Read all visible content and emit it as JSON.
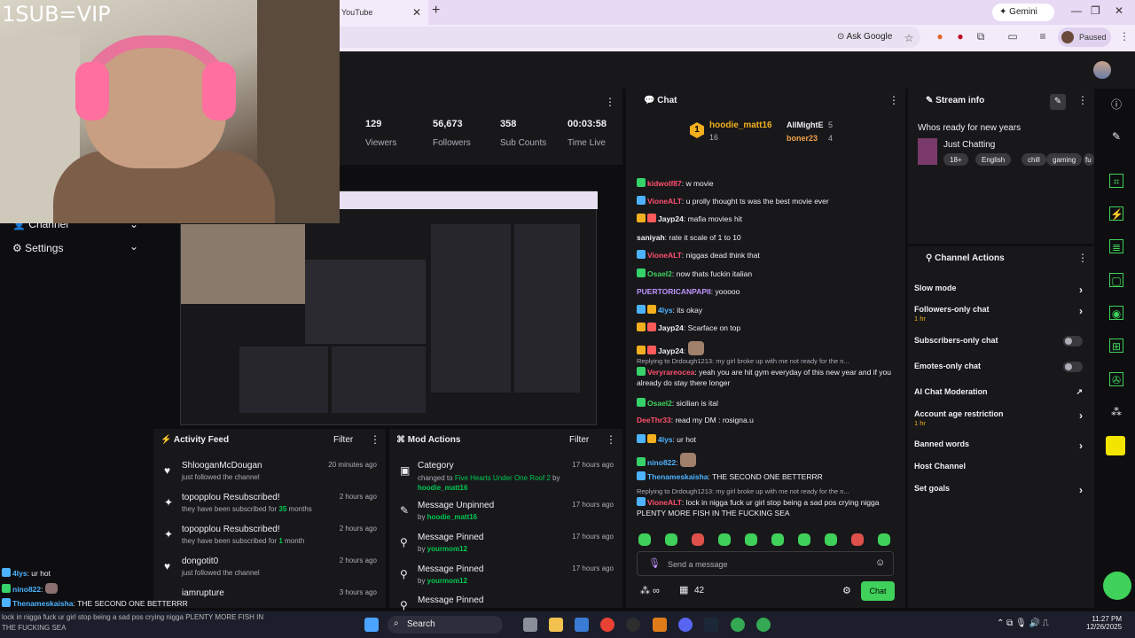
{
  "browser": {
    "tab_title": "YouTube",
    "gemini_label": "Gemini",
    "ask_google": "Ask Google",
    "paused": "Paused"
  },
  "webcam": {
    "tag": "1SUB=VIP"
  },
  "left_nav": [
    {
      "label": "Channel"
    },
    {
      "label": "Settings"
    }
  ],
  "stats": [
    {
      "value": "129",
      "label": "Viewers"
    },
    {
      "value": "56,673",
      "label": "Followers"
    },
    {
      "value": "358",
      "label": "Sub Counts"
    },
    {
      "value": "00:03:58",
      "label": "Time Live"
    }
  ],
  "activity_feed": {
    "title": "Activity Feed",
    "filter": "Filter",
    "items": [
      {
        "title": "ShlooganMcDougan",
        "sub": "just followed the channel",
        "time": "20 minutes ago"
      },
      {
        "title": "topopplou Resubscribed!",
        "sub_pre": "they have been subscribed for ",
        "sub_num": "35",
        "sub_post": " months",
        "time": "2 hours ago"
      },
      {
        "title": "topopplou Resubscribed!",
        "sub_pre": "they have been subscribed for ",
        "sub_num": "1",
        "sub_post": " month",
        "time": "2 hours ago"
      },
      {
        "title": "dongotit0",
        "sub": "just followed the channel",
        "time": "2 hours ago"
      },
      {
        "title": "iamrupture",
        "time": "3 hours ago"
      }
    ]
  },
  "mod_actions": {
    "title": "Mod Actions",
    "filter": "Filter",
    "items": [
      {
        "title": "Category",
        "sub_pre": "changed to ",
        "sub_green": "Five Hearts Under One Roof 2",
        "sub_mid": " by",
        "sub_user": "hoodie_matt16",
        "time": "17 hours ago"
      },
      {
        "title": "Message Unpinned",
        "sub_pre": "by ",
        "sub_user": "hoodie_matt16",
        "time": "17 hours ago"
      },
      {
        "title": "Message Pinned",
        "sub_pre": "by ",
        "sub_user": "yourmom12",
        "time": "17 hours ago"
      },
      {
        "title": "Message Pinned",
        "sub_pre": "by ",
        "sub_user": "yourmom12",
        "time": "17 hours ago"
      },
      {
        "title": "Message Pinned",
        "time": ""
      }
    ]
  },
  "chat": {
    "title": "Chat",
    "leaderboard": {
      "first": {
        "name": "hoodie_matt16",
        "count": "16"
      },
      "second": {
        "name": "AllMightE",
        "count": "5"
      },
      "third": {
        "name": "boner23",
        "count": "4"
      }
    },
    "messages": [
      {
        "user": "kidwolf87",
        "color": "#ff4f6e",
        "text": ": w movie"
      },
      {
        "user": "VioneALT",
        "color": "#ff4f6e",
        "text": ": u prolly thought ts was the best movie ever"
      },
      {
        "user": "Jayp24",
        "color": "#efeff1",
        "text": ": mafia movies hit"
      },
      {
        "user": "saniyah",
        "color": "#efeff1",
        "text": ": rate it scale of 1 to 10"
      },
      {
        "user": "VioneALT",
        "color": "#ff4f6e",
        "text": ": niggas dead think that"
      },
      {
        "user": "Osael2",
        "color": "#3fd15a",
        "text": ": now thats fuckin italian"
      },
      {
        "user": "PUERTORICANPAPII",
        "color": "#bf94ff",
        "text": ": yooooo"
      },
      {
        "user": "4lys",
        "color": "#4db3ff",
        "text": ": its okay"
      },
      {
        "user": "Jayp24",
        "color": "#efeff1",
        "text": ": Scarface on top"
      },
      {
        "user": "Jayp24",
        "color": "#efeff1",
        "text": ":"
      },
      {
        "reply": "Replying to Drdough1213: my girl broke up with me not ready for the n...",
        "user": "Veryrareocea",
        "color": "#ff4f6e",
        "text": ": yeah you are hit gym everyday of this new year and if you already do stay there longer"
      },
      {
        "user": "Osael2",
        "color": "#3fd15a",
        "text": ": sicilian is ital"
      },
      {
        "user": "DeeThr33",
        "color": "#ff4f6e",
        "text": ": read my DM : rosigna.u"
      },
      {
        "user": "4lys",
        "color": "#4db3ff",
        "text": ": ur hot"
      },
      {
        "user": "nino822",
        "color": "#4db3ff",
        "text": ":"
      },
      {
        "user": "Thenameskaisha",
        "color": "#4db3ff",
        "text": ": THE SECOND ONE BETTERRR"
      },
      {
        "reply": "Replying to Drdough1213: my girl broke up with me not ready for the n...",
        "user": "VioneALT",
        "color": "#ff4f6e",
        "text": ": lock in nigga fuck ur girl stop being a sad pos crying nigga PLENTY MORE FISH IN THE FUCKING SEA"
      }
    ],
    "send_placeholder": "Send a message",
    "points": "42",
    "chat_button": "Chat"
  },
  "stream_info": {
    "title": "Stream info",
    "stream_title": "Whos ready for new years",
    "category": "Just Chatting",
    "tags": [
      "18+",
      "English",
      "chill",
      "gaming",
      "fu"
    ]
  },
  "channel_actions": {
    "title": "Channel Actions",
    "items": [
      {
        "label": "Slow mode",
        "control": "chevron"
      },
      {
        "label": "Followers-only chat",
        "sub": "1 hr",
        "control": "chevron"
      },
      {
        "label": "Subscribers-only chat",
        "control": "toggle"
      },
      {
        "label": "Emotes-only chat",
        "control": "toggle"
      },
      {
        "label": "AI Chat Moderation",
        "control": "external"
      },
      {
        "label": "Account age restriction",
        "sub": "1 hr",
        "control": "chevron"
      },
      {
        "label": "Banned words",
        "control": "chevron"
      },
      {
        "label": "Host Channel",
        "control": "none"
      },
      {
        "label": "Set goals",
        "control": "chevron"
      }
    ]
  },
  "overlay_chat": [
    {
      "user": "4lys",
      "text": ": ur hot"
    },
    {
      "user": "nino822",
      "text": ":"
    },
    {
      "user": "Thenameskaisha",
      "text": ": THE SECOND ONE BETTERRR"
    }
  ],
  "ticker": "lock in nigga fuck ur girl stop being a sad pos crying nigga PLENTY MORE FISH IN THE FUCKING SEA",
  "taskbar": {
    "search": "Search",
    "time": "11:27 PM",
    "date": "12/26/2025"
  },
  "colors": {
    "accent_green": "#3fd15a",
    "gold": "#f2b01e",
    "purple": "#bf94ff"
  }
}
